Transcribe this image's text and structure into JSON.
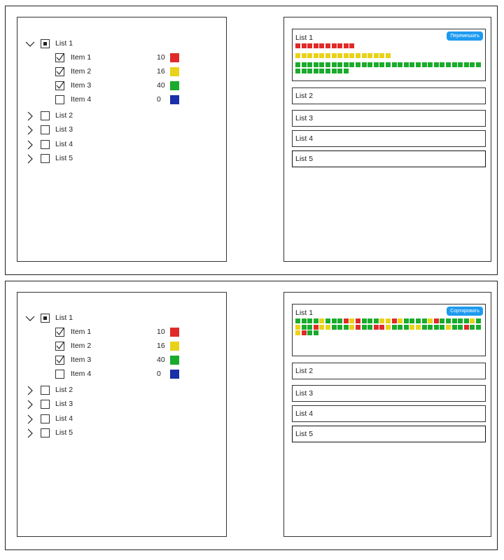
{
  "colors": {
    "red": "#e02a2a",
    "yellow": "#e8d21a",
    "green": "#1aab2c",
    "blue": "#1a2fa8",
    "button": "#1e9bf0"
  },
  "panels": [
    {
      "tree": {
        "list1": {
          "label": "List 1",
          "items": [
            {
              "label": "Item 1",
              "value": "10",
              "checked": true,
              "color": "red"
            },
            {
              "label": "Item 2",
              "value": "16",
              "checked": true,
              "color": "yellow"
            },
            {
              "label": "Item 3",
              "value": "40",
              "checked": true,
              "color": "green"
            },
            {
              "label": "Item 4",
              "value": "0",
              "checked": false,
              "color": "blue"
            }
          ]
        },
        "collapsed": [
          "List 2",
          "List 3",
          "List 4",
          "List 5"
        ]
      },
      "result": {
        "expanded_label": "List 1",
        "button_label": "Перемешать",
        "mode": "sorted",
        "others": [
          "List 2",
          "List 3",
          "List 4",
          "List 5"
        ]
      }
    },
    {
      "tree": {
        "list1": {
          "label": "List 1",
          "items": [
            {
              "label": "Item 1",
              "value": "10",
              "checked": true,
              "color": "red"
            },
            {
              "label": "Item 2",
              "value": "16",
              "checked": true,
              "color": "yellow"
            },
            {
              "label": "Item 3",
              "value": "40",
              "checked": true,
              "color": "green"
            },
            {
              "label": "Item 4",
              "value": "0",
              "checked": false,
              "color": "blue"
            }
          ]
        },
        "collapsed": [
          "List 2",
          "List 3",
          "List 4",
          "List 5"
        ]
      },
      "result": {
        "expanded_label": "List 1",
        "button_label": "Сортировать",
        "mode": "shuffled",
        "others": [
          "List 2",
          "List 3",
          "List 4",
          "List 5"
        ]
      }
    }
  ]
}
